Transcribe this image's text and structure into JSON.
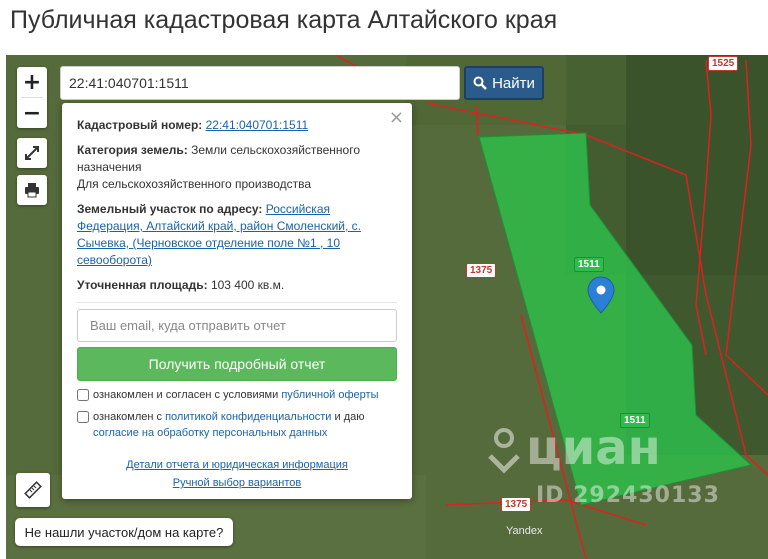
{
  "page": {
    "title": "Публичная кадастровая карта Алтайского края"
  },
  "search": {
    "value": "22:41:040701:1511",
    "button_label": "Найти"
  },
  "controls": {
    "zoom_in": "+",
    "zoom_out": "−"
  },
  "popup": {
    "close": "×",
    "cadastral_label": "Кадастровый номер:",
    "cadastral_value": "22:41:040701:1511",
    "category_label": "Категория земель:",
    "category_value": "Земли сельскохозяйственного назначения",
    "usage": "Для сельскохозяйственного производства",
    "address_label": "Земельный участок по адресу:",
    "address_value": "Российская Федерация, Алтайский край, район Смоленский, с. Сычевка, (Черновское отделение поле №1 , 10 севооборота)",
    "area_label": "Уточненная площадь:",
    "area_value": "103 400 кв.м.",
    "email_placeholder": "Ваш email, куда отправить отчет",
    "report_button": "Получить подробный отчет",
    "consent1_text": "ознакомлен и согласен с условиями ",
    "consent1_link": "публичной оферты",
    "consent2_text": "ознакомлен с ",
    "consent2_link": "политикой конфиденциальности",
    "consent2_mid": " и даю",
    "consent2_link2": "согласие на обработку персональных данных",
    "details_link": "Детали отчета и юридическая информация",
    "manual_link": "Ручной выбор вариантов"
  },
  "map": {
    "labels": {
      "plot_1511_a": "1511",
      "plot_1511_b": "1511",
      "plot_1375_a": "1375",
      "plot_1375_b": "1375",
      "plot_1525": "1525"
    },
    "yandex": "Yandex",
    "watermark": "циан",
    "watermark_id": "ID 292430133",
    "parcel_color": "#2ebc4a",
    "boundary_color": "#e02020"
  },
  "not_found_button": "Не нашли участок/дом на карте?"
}
